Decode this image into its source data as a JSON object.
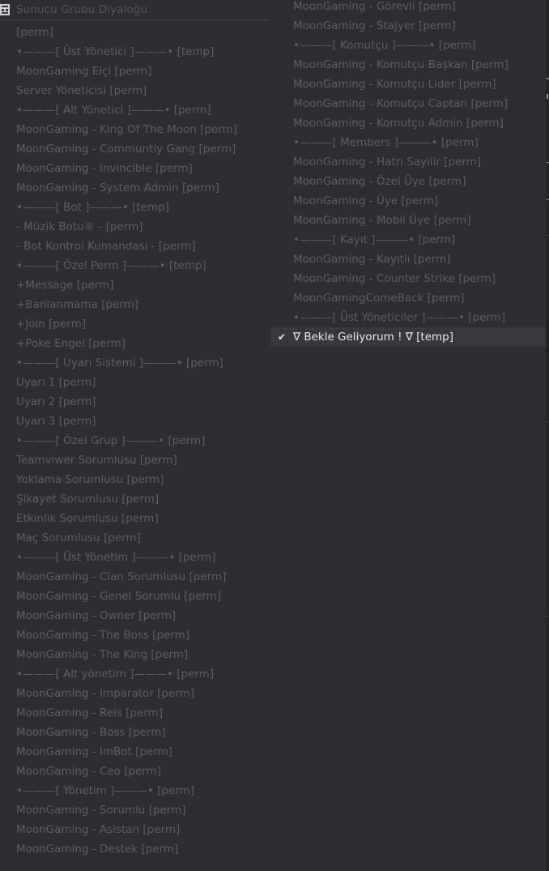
{
  "window": {
    "title": "Sunucu Grubu Diyaloğu",
    "icon": "group-dialog-icon"
  },
  "groups_left": [
    "[perm]",
    "•———[ Üst Yönetici ]———• [temp]",
    "MoonGaming Elçi [perm]",
    "Server Yöneticisi [perm]",
    "•———[ Alt Yönetici ]———• [perm]",
    "MoonGaming - King Of The Moon [perm]",
    "MoonGaming - Communtiy Gang [perm]",
    "MoonGaming - Invincible [perm]",
    "MoonGaming - System Admin [perm]",
    "•———[ Bot ]———• [temp]",
    "- Müzik Botu® - [perm]",
    "- Bot Kontrol Kumandası - [perm]",
    "•———[ Özel Perm ]———• [temp]",
    "+Message [perm]",
    "+Banlanmama [perm]",
    "+Join [perm]",
    "+Poke Engel [perm]",
    "•———[ Uyarı Sistemi ]———• [perm]",
    "Uyarı 1 [perm]",
    "Uyarı 2 [perm]",
    "Uyarı 3 [perm]",
    "•———[ Özel Grup ]———• [perm]",
    "Teamviwer Sorumlusu [perm]",
    "Yoklama Sorumlusu [perm]",
    "Şikayet Sorumlusu [perm]",
    "Etkinlik Sorumlusu [perm]",
    "Maç Sorumlusu [perm]",
    "•———[ Üst Yönetim ]———• [perm]",
    "MoonGaming - Clan Sorumlusu [perm]",
    "MoonGaming - Genel Sorumlu [perm]",
    "MoonGaming - Owner [perm]",
    "MoonGaming - The Boss [perm]",
    "MoonGaming - The King [perm]",
    "•———[ Alt yönetim ]———• [perm]",
    "MoonGaming - Imparator [perm]",
    "MoonGaming - Reis [perm]",
    "MoonGaming - Boss [perm]",
    "MoonGaming - ImBot [perm]",
    "MoonGaming - Ceo [perm]",
    "•———[ Yönetim ]———• [perm]",
    "MoonGaming - Sorumlu [perm]",
    "MoonGaming - Asistan [perm]",
    "MoonGaming - Destek [perm]"
  ],
  "groups_right": [
    "MoonGaming - Görevli [perm]",
    "MoonGaming - Stajyer [perm]",
    "•———[ Komutçu ]———• [perm]",
    "MoonGaming - Komutçu Başkan [perm]",
    "MoonGaming - Komutçu Lider [perm]",
    "MoonGaming - Komutçu Captan [perm]",
    "MoonGaming - Komutçu Admin [perm]",
    "•———[ Members ]———• [perm]",
    "MoonGaming - Hatrı Sayilir [perm]",
    "MoonGaming - Özel Üye [perm]",
    "MoonGaming - Üye [perm]",
    "MoonGaming - Mobil Üye [perm]",
    "•———[ Kayıt ]———• [perm]",
    "MoonGaming - Kayıtlı [perm]",
    "MoonGaming - Counter Strike [perm]",
    "MoonGamingComeBack [perm]",
    "•———[ Üst Yöneticiler ]———• [perm]"
  ],
  "selected_group": {
    "checkmark": "✔",
    "label": "∇ Bekle Geliyorum ! ∇  [temp]"
  },
  "colors": {
    "background": "#2d2e33",
    "disabled_text": "#5c5e65",
    "selected_text": "#e9e9eb",
    "selected_row": "#37383d"
  }
}
